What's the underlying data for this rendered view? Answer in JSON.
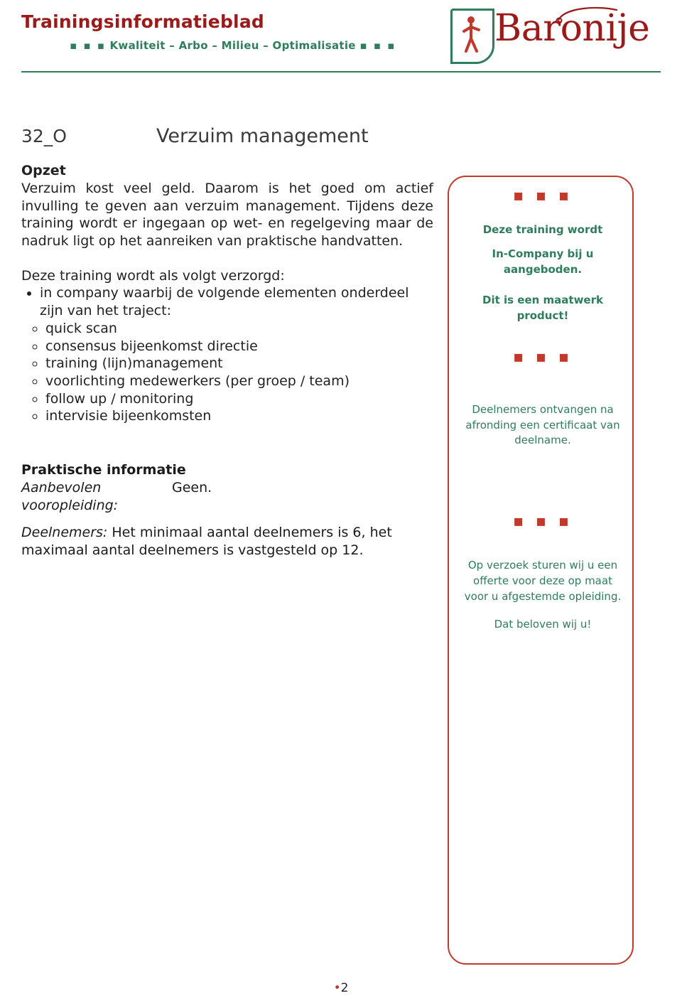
{
  "header": {
    "title": "Trainingsinformatieblad",
    "subtitle": "Kwaliteit – Arbo – Milieu – Optimalisatie",
    "dots_left": "▪ ▪ ▪",
    "dots_right": "▪ ▪ ▪",
    "logo_word": "Baronije",
    "accent_red": "#9b1b1b",
    "accent_green": "#2e7d5b",
    "panel_red": "#c0392b"
  },
  "document": {
    "code": "32_O",
    "title": "Verzuim management"
  },
  "opzet": {
    "heading": "Opzet",
    "paragraph": "Verzuim kost veel geld. Daarom is het goed om actief invulling te geven aan verzuim management.  Tijdens deze training wordt er ingegaan op wet- en regelgeving maar de nadruk ligt op het aanreiken van praktische handvatten.",
    "lead": "Deze training wordt als volgt verzorgd:",
    "bullets": [
      "in company waarbij de volgende elementen onderdeel zijn van het traject:"
    ],
    "subitems": [
      "quick scan",
      "consensus bijeenkomst directie",
      "training (lijn)management",
      "voorlichting medewerkers (per groep / team)",
      "follow up / monitoring",
      "intervisie bijeenkomsten"
    ]
  },
  "praktisch": {
    "heading": "Praktische informatie",
    "vooropleiding_label": "Aanbevolen vooropleiding:",
    "vooropleiding_value": "Geen.",
    "deelnemers_label": "Deelnemers:",
    "deelnemers_value": "Het minimaal aantal deelnemers is 6, het maximaal aantal deelnemers is vastgesteld op 12."
  },
  "sidebar": {
    "block1_line1": "Deze training wordt",
    "block1_line2": "In-Company bij u aangeboden.",
    "block1_line3": "Dit is een maatwerk product!",
    "block2": "Deelnemers ontvangen na afronding een certificaat van deelname.",
    "block3_line1": "Op verzoek sturen wij u een offerte voor deze op maat voor u afgestemde opleiding.",
    "block3_line2": "Dat beloven wij u!"
  },
  "footer": {
    "bullet": "•",
    "page": "2"
  }
}
